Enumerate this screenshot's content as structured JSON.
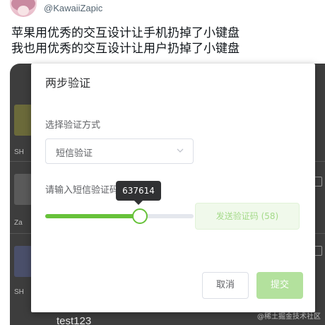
{
  "tweet": {
    "handle": "@KawaiiZapic",
    "lines": [
      "苹果用优秀的交互设计让手机扔掉了小键盘",
      "我也用优秀的交互设计让用户扔掉了小键盘"
    ]
  },
  "background": {
    "tags": [
      "SH",
      "Za",
      "SH"
    ],
    "bottom_text": "test123",
    "watermark": "@稀土掘金技术社区"
  },
  "dialog": {
    "title": "两步验证",
    "method_label": "选择验证方式",
    "method_value": "短信验证",
    "code_label": "请输入短信验证码",
    "slider": {
      "value_text": "637614",
      "fill_fraction": 0.64
    },
    "send_button": "发送验证码 (58)",
    "cancel_button": "取消",
    "submit_button": "提交"
  },
  "colors": {
    "accent": "#67c23a",
    "accent_disabled": "#b3e19d",
    "overlay": "#3d3d3d"
  },
  "icons": {
    "select_arrow": "chevron-down-icon"
  }
}
